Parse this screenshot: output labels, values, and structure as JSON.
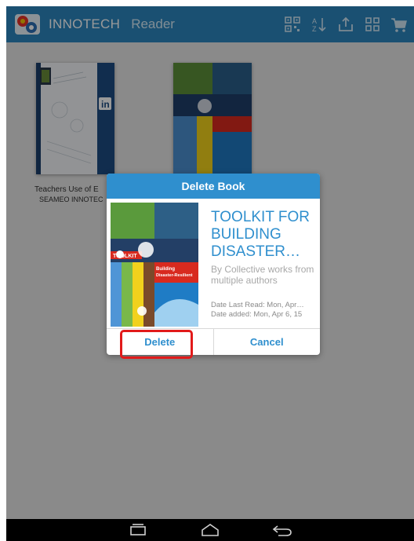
{
  "app": {
    "title": "INNOTECH",
    "subtitle": "Reader"
  },
  "toolbar_icons": [
    "qr-code-icon",
    "sort-az-icon",
    "share-upload-icon",
    "grid-view-icon",
    "cart-icon"
  ],
  "library": {
    "books": [
      {
        "title": "Teachers Use of E",
        "author": "SEAMEO INNOTEC"
      },
      {
        "title": "",
        "author": ""
      }
    ]
  },
  "dialog": {
    "header": "Delete Book",
    "book_title": "TOOLKIT FOR BUILDING DISASTER…",
    "author": "By Collective works from multiple authors",
    "last_read": "Date Last Read: Mon, Apr…",
    "date_added": "Date added: Mon, Apr 6, 15",
    "delete_label": "Delete",
    "cancel_label": "Cancel"
  },
  "colors": {
    "topbar": "#2c86bf",
    "dialog_header": "#2f8fce",
    "highlight": "#e21a1a",
    "background": "#e6e6e6"
  },
  "nav_icons": [
    "recent-apps-icon",
    "home-icon",
    "back-icon"
  ]
}
